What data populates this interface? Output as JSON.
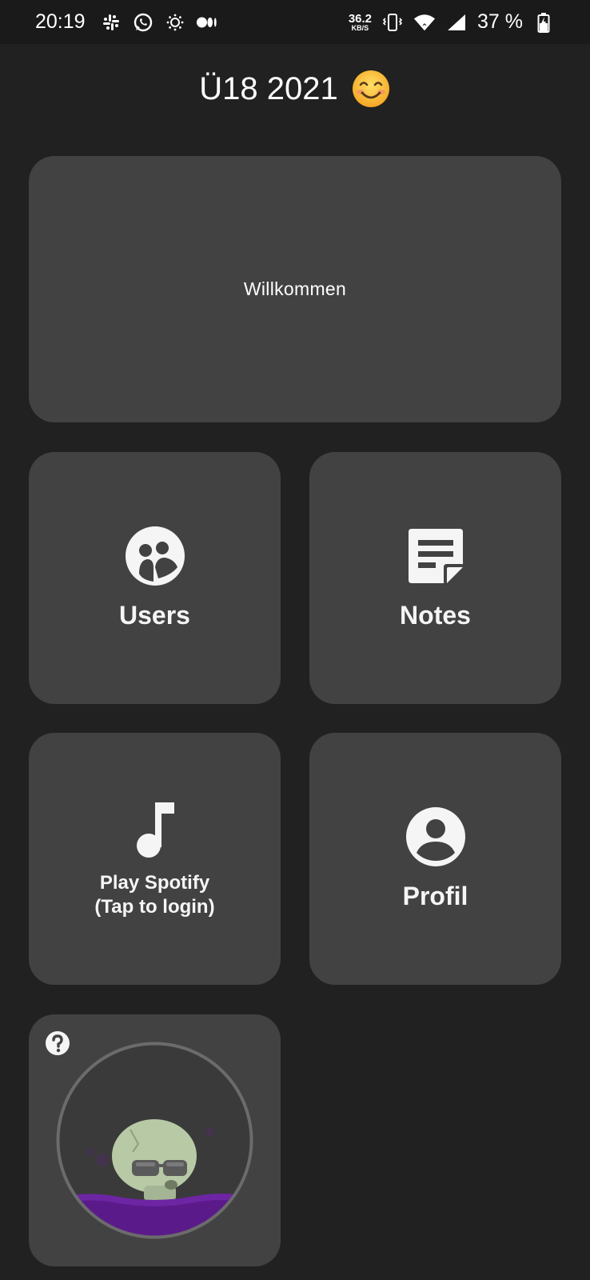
{
  "statusbar": {
    "time": "20:19",
    "icons_left": [
      "slack-icon",
      "whatsapp-icon",
      "sun-icon",
      "medium-icon"
    ],
    "net_speed_value": "36.2",
    "net_speed_unit": "KB/S",
    "icons_right": [
      "vibrate-icon",
      "wifi-icon",
      "cell-signal-icon",
      "battery-charging-icon"
    ],
    "battery_percent": "37 %"
  },
  "header": {
    "title": "Ü18 2021",
    "emoji": "smiling-face-emoji"
  },
  "tiles": {
    "welcome": {
      "label": "Willkommen"
    },
    "users": {
      "label": "Users",
      "icon": "group-icon"
    },
    "notes": {
      "label": "Notes",
      "icon": "note-icon"
    },
    "spotify": {
      "line1": "Play Spotify",
      "line2": "(Tap to login)",
      "icon": "music-note-icon"
    },
    "profil": {
      "label": "Profil",
      "icon": "account-circle-icon"
    },
    "game": {
      "help_icon": "help-icon",
      "illustration": "skull-in-cauldron"
    }
  },
  "colors": {
    "background": "#212121",
    "tile": "#424242",
    "statusbar": "#1a1a1a",
    "liquid": "#5b1a8a",
    "skull": "#b8c9a6"
  }
}
